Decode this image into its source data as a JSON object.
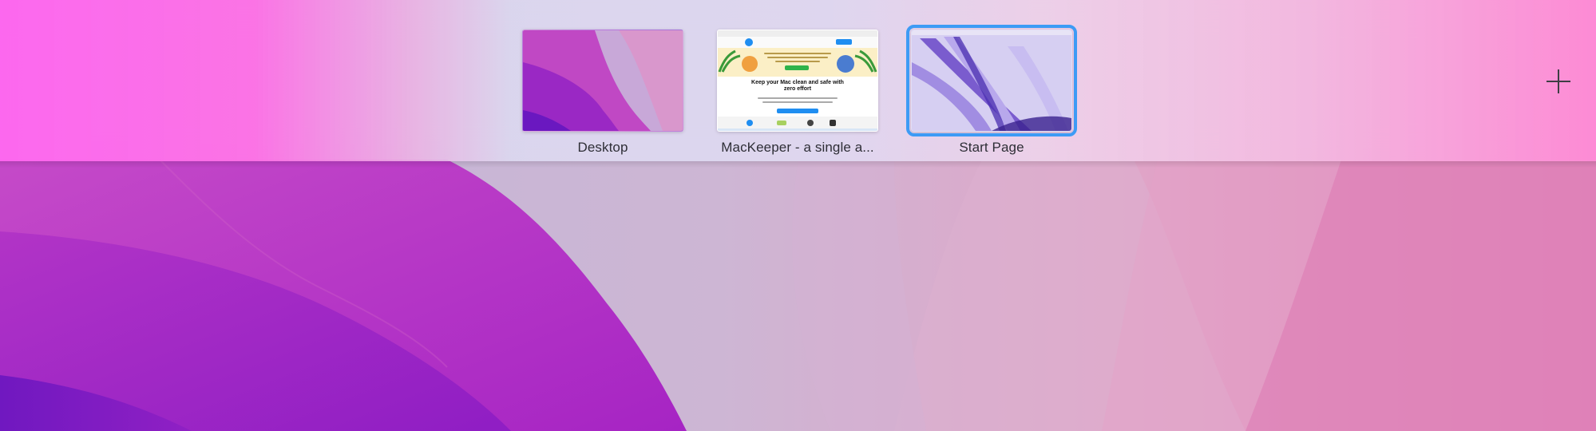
{
  "spaces": [
    {
      "label": "Desktop",
      "active": false
    },
    {
      "label": "MacKeeper - a single a...",
      "active": false
    },
    {
      "label": "Start Page",
      "active": true
    }
  ],
  "mackeeper_thumbnail": {
    "headline": "Keep your Mac clean and safe with zero effort"
  },
  "add_space": {
    "icon": "plus-icon"
  },
  "colors": {
    "active_outline": "#3d9bf5",
    "label_text": "#2e2e36",
    "accent_pink": "#ff64f0"
  }
}
